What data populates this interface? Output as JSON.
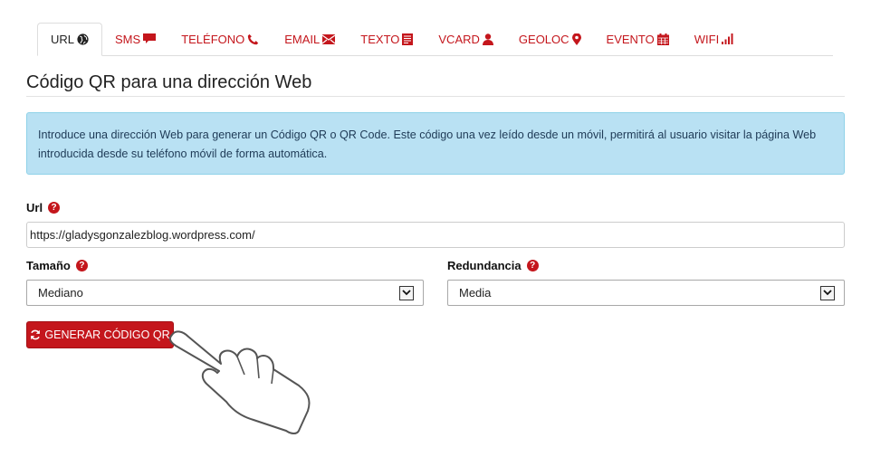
{
  "tabs": [
    {
      "label": "URL",
      "icon": "globe-icon",
      "active": true
    },
    {
      "label": "SMS",
      "icon": "comment-icon",
      "active": false
    },
    {
      "label": "TELÉFONO",
      "icon": "phone-icon",
      "active": false
    },
    {
      "label": "EMAIL",
      "icon": "envelope-icon",
      "active": false
    },
    {
      "label": "TEXTO",
      "icon": "document-icon",
      "active": false
    },
    {
      "label": "VCARD",
      "icon": "user-icon",
      "active": false
    },
    {
      "label": "GEOLOC",
      "icon": "map-marker-icon",
      "active": false
    },
    {
      "label": "EVENTO",
      "icon": "calendar-icon",
      "active": false
    },
    {
      "label": "WIFI",
      "icon": "signal-icon",
      "active": false
    }
  ],
  "section": {
    "title": "Código QR para una dirección Web"
  },
  "info": {
    "text": "Introduce una dirección Web para generar un Código QR o QR Code. Este código una vez leído desde un móvil, permitirá al usuario visitar la página Web introducida desde su teléfono móvil de forma automática."
  },
  "form": {
    "url_label": "Url",
    "url_value": "https://gladysgonzalezblog.wordpress.com/",
    "size_label": "Tamaño",
    "size_value": "Mediano",
    "redundancy_label": "Redundancia",
    "redundancy_value": "Media",
    "help_glyph": "?"
  },
  "button": {
    "label": "GENERAR CÓDIGO QR",
    "icon": "refresh-icon"
  },
  "colors": {
    "accent": "#c4161c",
    "info_bg": "#b9e1f3",
    "info_border": "#8fd2e8",
    "info_text": "#1e3a56"
  }
}
